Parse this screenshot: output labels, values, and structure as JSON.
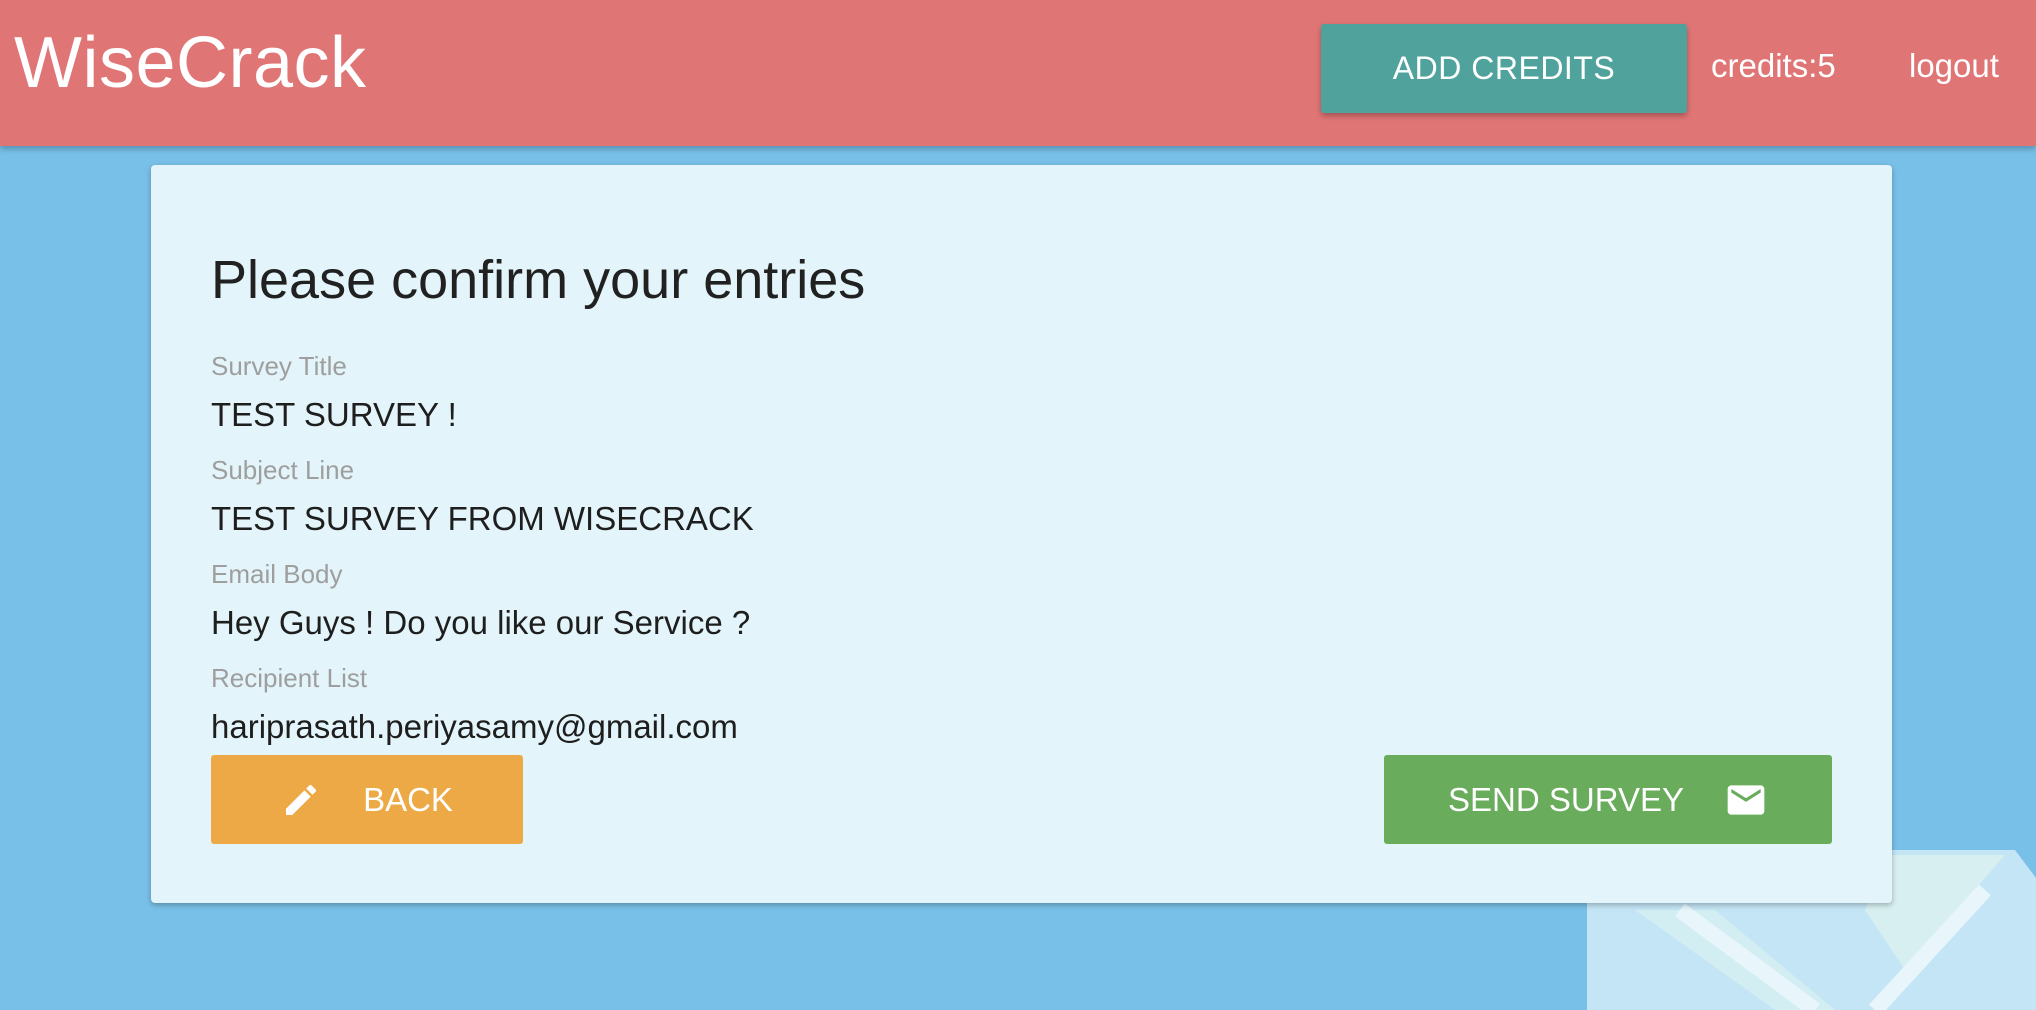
{
  "navbar": {
    "brand": "WiseCrack",
    "add_credits_label": "ADD CREDITS",
    "credits_text": "credits:5",
    "logout_label": "logout"
  },
  "review": {
    "title": "Please confirm your entries",
    "fields": [
      {
        "label": "Survey Title",
        "value": "TEST SURVEY !"
      },
      {
        "label": "Subject Line",
        "value": "TEST SURVEY FROM WISECRACK"
      },
      {
        "label": "Email Body",
        "value": "Hey Guys ! Do you like our Service ?"
      },
      {
        "label": "Recipient List",
        "value": "hariprasath.periyasamy@gmail.com"
      }
    ],
    "back_label": "BACK",
    "back_icon": "pencil-icon",
    "send_label": "SEND SURVEY",
    "send_icon": "mail-icon"
  },
  "colors": {
    "navbar": "#e07576",
    "background": "#79c0e8",
    "card": "#e3f5fa",
    "add_credits_button": "#4fa39c",
    "back_button": "#eea947",
    "send_button": "#68ac5c"
  }
}
